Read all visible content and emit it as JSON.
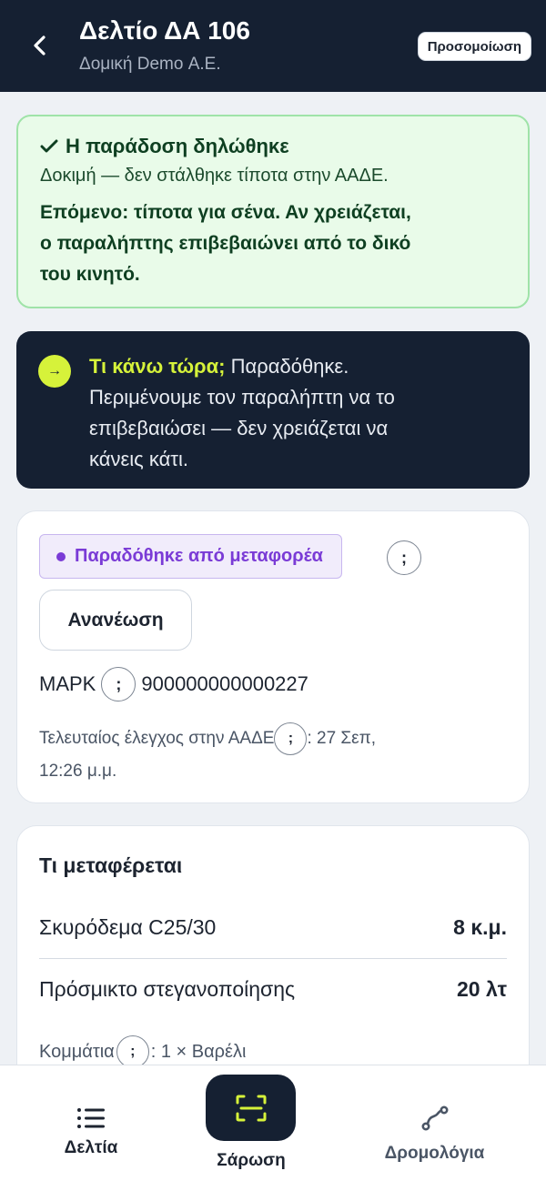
{
  "header": {
    "title": "Δελτίο ΔΑ 106",
    "subtitle": "Δομική Demo Α.Ε.",
    "simulation_label": "Προσομοίωση"
  },
  "success_banner": {
    "title": "Η παράδοση δηλώθηκε",
    "subtitle": "Δοκιμή — δεν στάλθηκε τίποτα στην ΑΑΔΕ.",
    "next_line1": "Επόμενο: τίποτα για σένα. Αν χρειάζεται,",
    "next_line2": "ο παραλήπτης επιβεβαιώνει από το δικό",
    "next_line3": "του κινητό."
  },
  "what_now": {
    "emphasis": "Τι κάνω τώρα;",
    "text_line1": " Παραδόθηκε.",
    "text_line2": "Περιμένουμε τον παραλήπτη να το",
    "text_line3": "επιβεβαιώσει — δεν χρειάζεται να",
    "text_line4": "κάνεις κάτι."
  },
  "status_card": {
    "status_label": "Παραδόθηκε από μεταφορέα",
    "refresh_label": "Ανανέωση",
    "mark_label": "ΜΑΡΚ",
    "mark_value": "900000000000227",
    "last_check_label": "Τελευταίος έλεγχος στην ΑΑΔΕ",
    "last_check_value_1": ": 27 Σεπ,",
    "last_check_value_2": "12:26 μ.μ.",
    "help_glyph": ";"
  },
  "items_card": {
    "title": "Τι μεταφέρεται",
    "items": [
      {
        "name": "Σκυρόδεμα C25/30",
        "qty": "8 κ.μ."
      },
      {
        "name": "Πρόσμικτο στεγανοποίησης",
        "qty": "20 λτ"
      }
    ],
    "pieces_label": "Κομμάτια",
    "pieces_value": ": 1 × Βαρέλι"
  },
  "bottom_nav": {
    "deltia": "Δελτία",
    "scan": "Σάρωση",
    "routes": "Δρομολόγια"
  },
  "colors": {
    "header_bg": "#152032",
    "accent_lime": "#d6f23a",
    "success_bg": "#e9fbe9",
    "status_purple": "#7a3bd6"
  },
  "icons": [
    "back-arrow-icon",
    "checkmark-icon",
    "arrow-right-icon",
    "list-icon",
    "scan-icon",
    "route-icon"
  ]
}
